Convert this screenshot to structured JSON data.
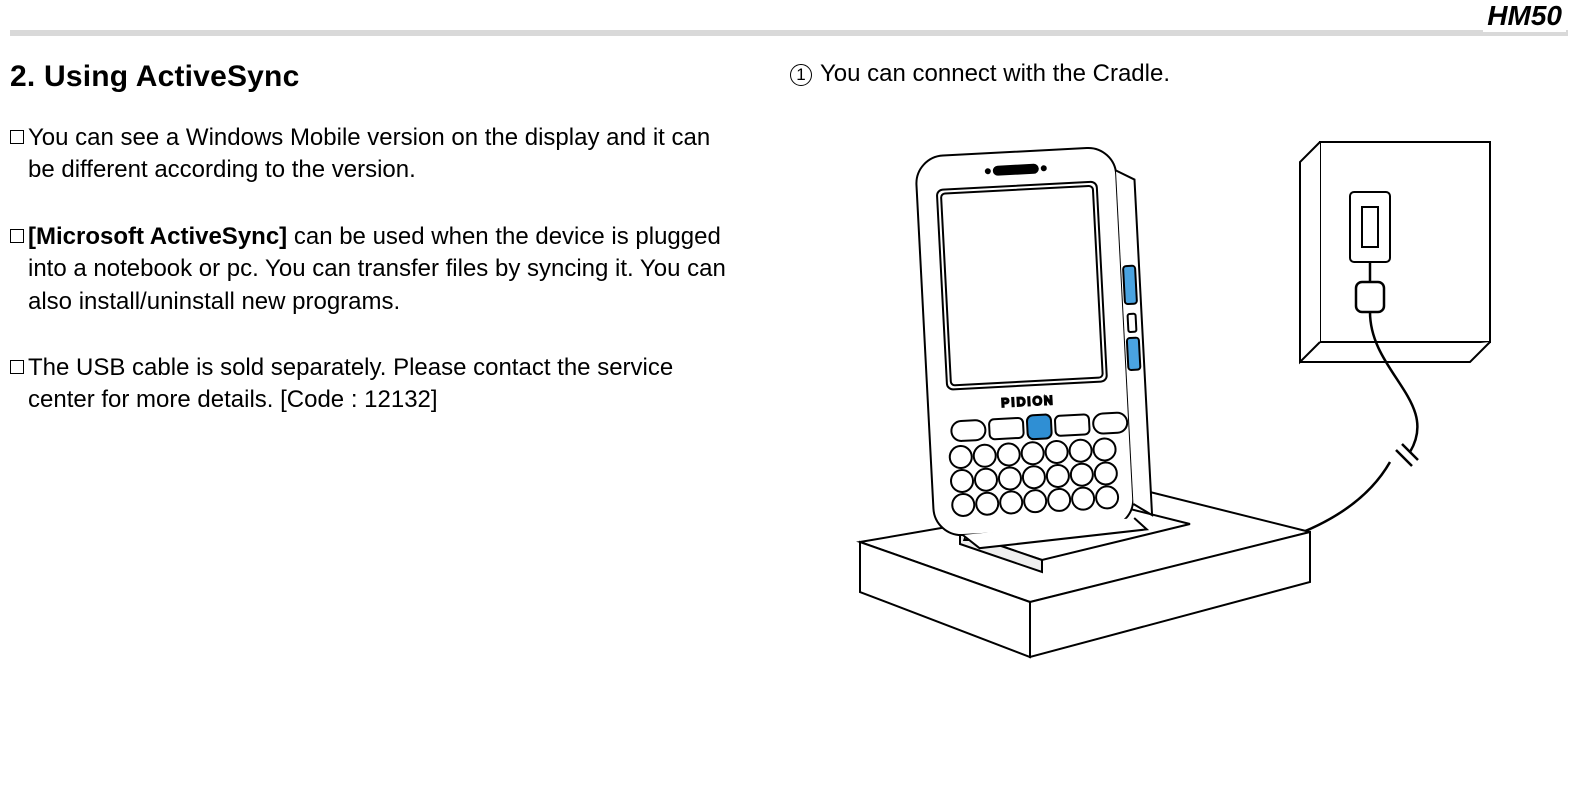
{
  "header": {
    "model": "HM50"
  },
  "section": {
    "heading": "2. Using ActiveSync"
  },
  "left": {
    "p1": "You can see a Windows Mobile version on the display and it can be different according to the version.",
    "p2_bold": "[Microsoft ActiveSync]",
    "p2_rest": " can be used when the device is plugged into a notebook or pc. You can transfer files by syncing it. You can also install/uninstall new programs.",
    "p3": "The USB cable is sold separately. Please contact the service center for more details. [Code : 12132]"
  },
  "right": {
    "step1_num": "1",
    "step1_text": "You can connect with the Cradle."
  },
  "device": {
    "brand": "PIDION"
  }
}
